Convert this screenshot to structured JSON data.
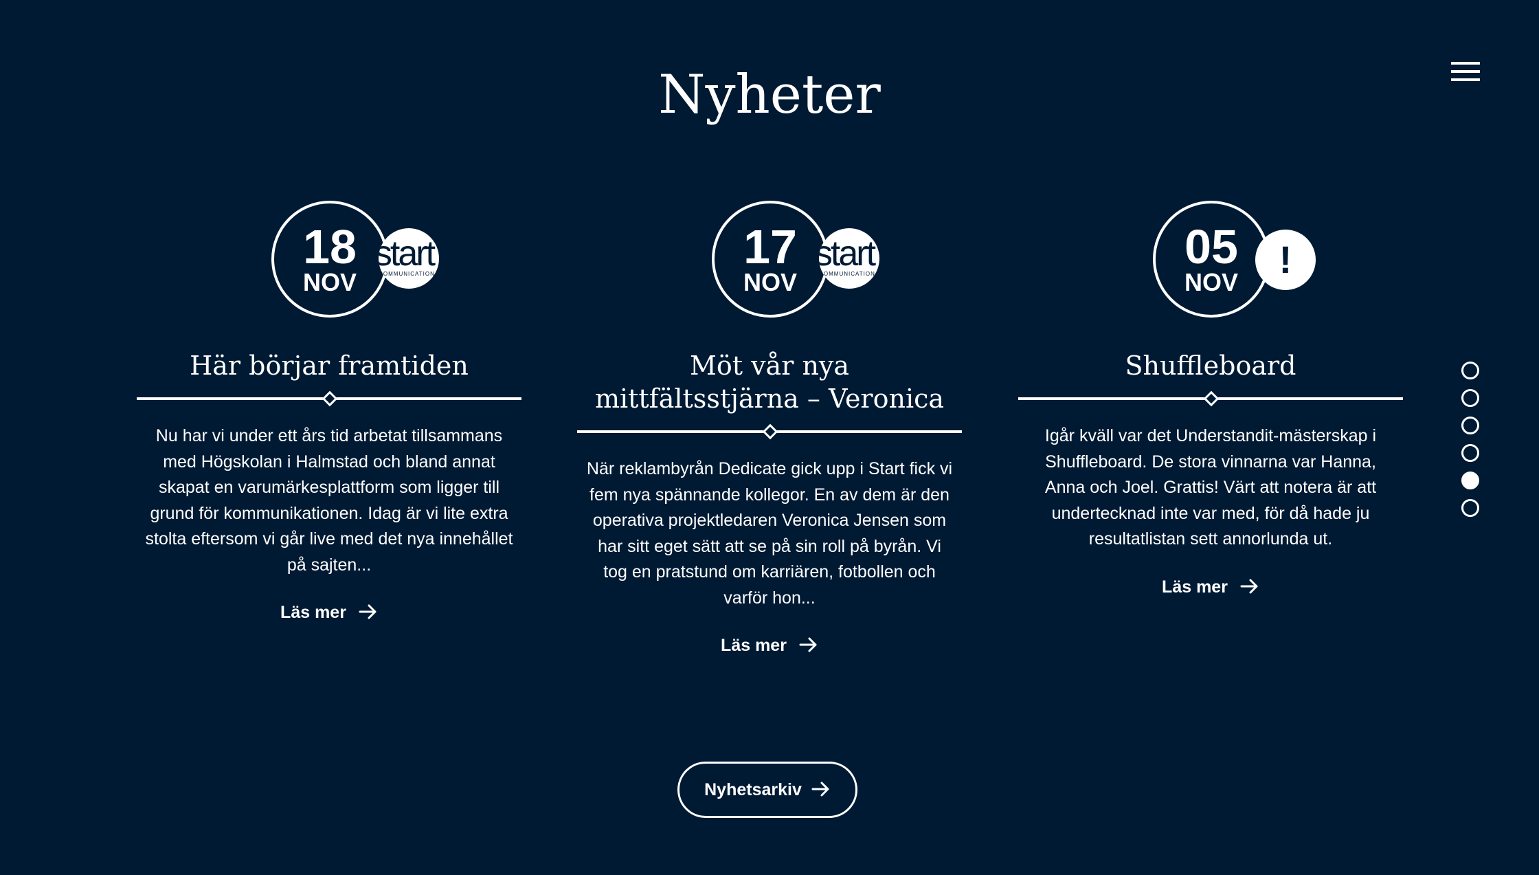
{
  "page": {
    "title": "Nyheter"
  },
  "colors": {
    "background": "#001a33",
    "foreground": "#ffffff"
  },
  "menu": {
    "icon": "hamburger-menu-icon"
  },
  "news": [
    {
      "day": "18",
      "month": "NOV",
      "logo_text": "start",
      "logo_subtext": "COMMUNICATION",
      "title": "Här börjar framtiden",
      "excerpt": "Nu har vi under ett års tid arbetat tillsammans med Högskolan i Halmstad och bland annat skapat en varumärkesplattform som ligger till grund för kommunikationen. Idag är vi lite extra stolta eftersom vi går live med det nya innehållet på sajten...",
      "link_label": "Läs mer"
    },
    {
      "day": "17",
      "month": "NOV",
      "logo_text": "start",
      "logo_subtext": "COMMUNICATION",
      "title": "Möt vår nya mittfältsstjärna – Veronica",
      "excerpt": "När reklambyrån Dedicate gick upp i Start fick vi fem nya spännande kollegor. En av dem är den operativa projektledaren Veronica Jensen som har sitt eget sätt att se på sin roll på byrån. Vi tog en pratstund om karriären, fotbollen och varför hon...",
      "link_label": "Läs mer"
    },
    {
      "day": "05",
      "month": "NOV",
      "logo_text": "!",
      "title": "Shuffleboard",
      "excerpt": "Igår kväll var det Understandit-mästerskap i Shuffleboard. De stora vinnarna var Hanna, Anna och Joel. Grattis! Värt att notera är att undertecknad inte var med, för då hade ju resultatlistan sett annorlunda ut.",
      "link_label": "Läs mer"
    }
  ],
  "pagination": {
    "total": 6,
    "active_index": 4
  },
  "archive_button": {
    "label": "Nyhetsarkiv"
  }
}
